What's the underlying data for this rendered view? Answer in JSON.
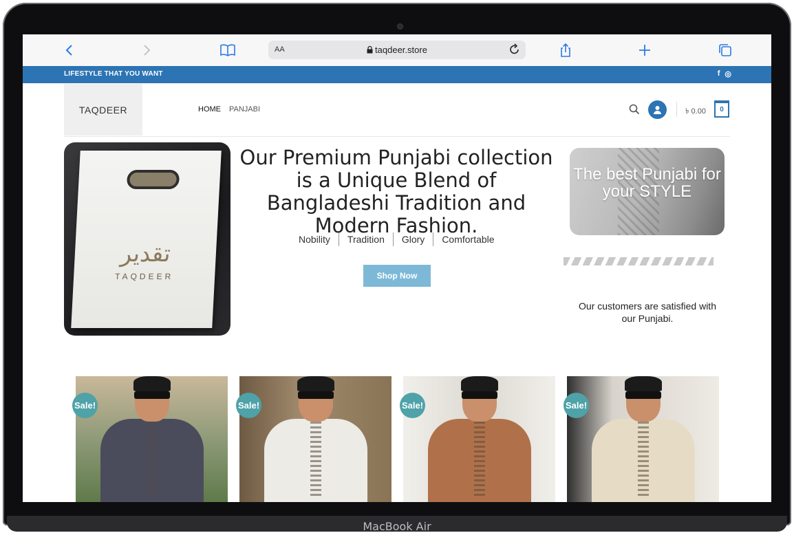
{
  "device": {
    "label": "MacBook Air"
  },
  "browser": {
    "url": "taqdeer.store",
    "reader_label": "AA",
    "icons": [
      "back-icon",
      "forward-icon",
      "bookmarks-icon",
      "lock-icon",
      "reload-icon",
      "share-icon",
      "new-tab-icon",
      "tabs-icon"
    ]
  },
  "topbar": {
    "tagline": "LIFESTYLE THAT YOU WANT",
    "social": {
      "facebook": "f",
      "instagram": "◎"
    }
  },
  "header": {
    "logo": "TAQDEER",
    "nav": [
      "HOME",
      "PANJABI"
    ],
    "cart_total": "৳ 0.00",
    "cart_count": "0"
  },
  "hero": {
    "bag_arabic": "تقدير",
    "bag_brand": "TAQDEER",
    "headline": "Our Premium Punjabi collection is a Unique Blend of Bangladeshi Tradition and Modern Fashion.",
    "features": [
      "Nobility",
      "Tradition",
      "Glory",
      "Comfortable"
    ],
    "cta": "Shop Now",
    "promo": "The best Punjabi for your STYLE",
    "satisfied": "Our customers are satisfied with our Punjabi."
  },
  "products": [
    {
      "badge": "Sale!",
      "color": "#4a4c5c",
      "bg": "#8e9a78"
    },
    {
      "badge": "Sale!",
      "color": "#ecebe6",
      "bg": "#9a8467"
    },
    {
      "badge": "Sale!",
      "color": "#b0714a",
      "bg": "#e4e2dc"
    },
    {
      "badge": "Sale!",
      "color": "#e6dcc6",
      "bg": "#d7d3cc"
    }
  ],
  "colors": {
    "brand_blue": "#2c74b3",
    "button": "#7db9d7",
    "sale_badge": "#4ea2a8"
  }
}
